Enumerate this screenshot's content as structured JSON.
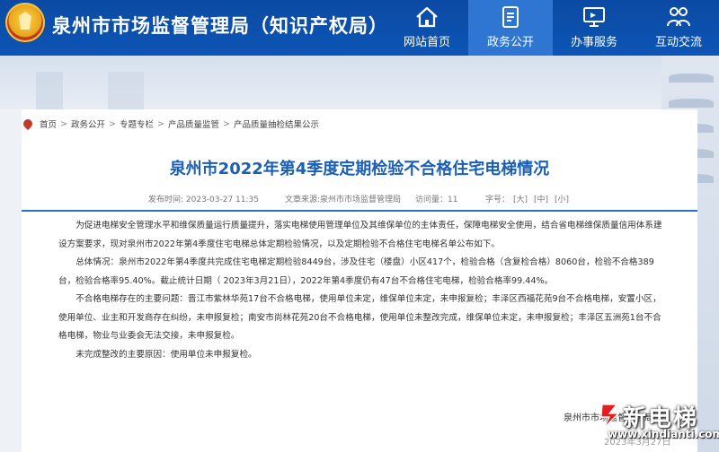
{
  "header": {
    "site_title": "泉州市市场监督管理局（知识产权局）",
    "nav": [
      {
        "label": "网站首页",
        "icon": "home-icon"
      },
      {
        "label": "政务公开",
        "icon": "document-icon",
        "active": true
      },
      {
        "label": "办事服务",
        "icon": "monitor-icon"
      },
      {
        "label": "互动交流",
        "icon": "people-icon"
      }
    ],
    "bg_color": "#0b4aa3",
    "active_color": "#2f76d3"
  },
  "breadcrumb": [
    "首页",
    "政务公开",
    "专题专栏",
    "产品质量监管",
    "产品质量抽检结果公示"
  ],
  "article": {
    "title": "泉州市2022年第4季度定期检验不合格住宅电梯情况",
    "title_color": "#1a5fb4",
    "publish_time": "发布时间: 2023-03-27 11:35",
    "source": "文章来源:泉州市市场监督管理局",
    "views": "访问量：11",
    "font_size_label": "字号：",
    "font_sizes": [
      "[大]",
      "[中]",
      "[小]"
    ],
    "paragraphs": [
      "为促进电梯安全管理水平和维保质量运行质量提升，落实电梯使用管理单位及其维保单位的主体责任，保障电梯安全使用，结合省电梯维保质量信用体系建设方案要求，现对泉州市2022年第4季度住宅电梯总体定期检验情况，以及定期检验不合格住宅电梯名单公布如下。",
      "总体情况：泉州市2022年第4季度共完成住宅电梯定期检验8449台，涉及住宅（楼盘）小区417个，检验合格（含复检合格）8060台，检验不合格389台，检验合格率95.40%。截止统计日期（ 2023年3月21日），2022年第4季度仍有47台不合格住宅电梯，检验合格率99.44%。",
      "不合格电梯存在的主要问题：晋江市紫林华苑17台不合格电梯，使用单位未定，维保单位未定，未申报复检；丰泽区西福花苑9台不合格电梯，安置小区，使用单位、业主和开发商存在纠纷，未申报复检；南安市尚林花苑20台不合格电梯，使用单位未整改完成，维保单位未定，未申报复检；丰泽区五洲苑1台不合格电梯，物业与业委会无法交接，未申报复检。",
      "未完成整改的主要原因：使用单位未申报复检。"
    ]
  },
  "watermark": {
    "org": "泉州市市场监督管理局",
    "date": "2023年3月27日",
    "brand": "新电梯",
    "url": "www.xindianti.com"
  }
}
